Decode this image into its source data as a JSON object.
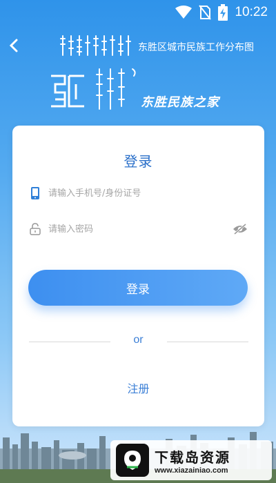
{
  "status_bar": {
    "time": "10:22",
    "icons": [
      "wifi-icon",
      "no-sim-icon",
      "battery-charging-icon"
    ]
  },
  "header": {
    "back_icon": "chevron-left-icon",
    "mongolian_title_image": "mongolian-script-title",
    "title": "东胜区城市民族工作分布图"
  },
  "logo": {
    "emblem": "mongolian-script-emblem",
    "text": "东胜民族之家"
  },
  "login_card": {
    "title": "登录",
    "phone_field": {
      "icon": "mobile-phone-icon",
      "placeholder": "请输入手机号/身份证号",
      "value": ""
    },
    "password_field": {
      "icon": "lock-icon",
      "placeholder": "请输入密码",
      "value": "",
      "toggle_icon": "eye-hidden-icon"
    },
    "login_button": "登录",
    "separator": "or",
    "register_link": "注册"
  },
  "watermark": {
    "title": "下载岛资源",
    "url": "www.xiazainiao.com"
  },
  "colors": {
    "background_top": "#2f93ea",
    "accent_blue": "#3b7fd6",
    "button_gradient_start": "#3d8ff0",
    "button_gradient_end": "#5fa9f6"
  }
}
